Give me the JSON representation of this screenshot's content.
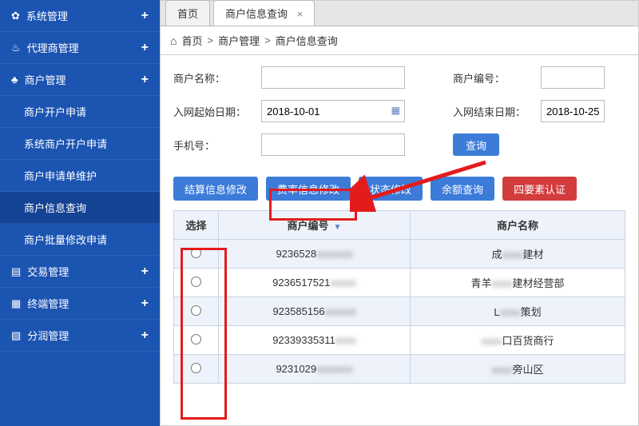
{
  "sidebar": {
    "items": [
      {
        "label": "系统管理",
        "icon": "gear"
      },
      {
        "label": "代理商管理",
        "icon": "group"
      },
      {
        "label": "商户管理",
        "icon": "merchant",
        "expanded": true,
        "children": [
          {
            "label": "商户开户申请"
          },
          {
            "label": "系统商户开户申请"
          },
          {
            "label": "商户申请单维护"
          },
          {
            "label": "商户信息查询",
            "active": true
          },
          {
            "label": "商户批量修改申请"
          }
        ]
      },
      {
        "label": "交易管理",
        "icon": "book"
      },
      {
        "label": "终端管理",
        "icon": "terminal"
      },
      {
        "label": "分润管理",
        "icon": "chart"
      }
    ]
  },
  "tabs": [
    {
      "label": "首页",
      "active": false,
      "closable": false
    },
    {
      "label": "商户信息查询",
      "active": true,
      "closable": true
    }
  ],
  "breadcrumb": {
    "home": "首页",
    "mid": "商户管理",
    "leaf": "商户信息查询",
    "sep": ">"
  },
  "form": {
    "merchant_name_label": "商户名称：",
    "merchant_no_label": "商户编号：",
    "start_date_label": "入网起始日期：",
    "start_date_value": "2018-10-01",
    "end_date_label": "入网结束日期：",
    "end_date_value": "2018-10-25",
    "phone_label": "手机号：",
    "query_btn": "查询"
  },
  "action_buttons": {
    "b1": "结算信息修改",
    "b2": "费率信息修改",
    "b3": "状态修改",
    "b4": "余额查询",
    "b5": "四要素认证"
  },
  "table": {
    "cols": {
      "select": "选择",
      "no": "商户编号",
      "name": "商户名称"
    },
    "rows": [
      {
        "no_prefix": "9236528",
        "no_blur": "xxxxxxx",
        "name_prefix": "成",
        "name_blur": "xxxx",
        "name_suffix": "建材"
      },
      {
        "no_prefix": "9236517521",
        "no_blur": "xxxxx",
        "name_prefix": "青羊",
        "name_blur": "xxxx",
        "name_suffix": "建材经营部"
      },
      {
        "no_prefix": "923585156",
        "no_blur": "xxxxxx",
        "name_prefix": "L",
        "name_blur": "xxxx",
        "name_suffix": "策划"
      },
      {
        "no_prefix": "92339335311",
        "no_blur": "xxxx",
        "name_prefix": "",
        "name_blur": "xxxx",
        "name_suffix": "口百货商行"
      },
      {
        "no_prefix": "9231029",
        "no_blur": "xxxxxxx",
        "name_prefix": "",
        "name_blur": "xxxx",
        "name_suffix": "旁山区"
      }
    ]
  },
  "ui_text": {
    "close_glyph": "×",
    "plus_glyph": "+"
  }
}
